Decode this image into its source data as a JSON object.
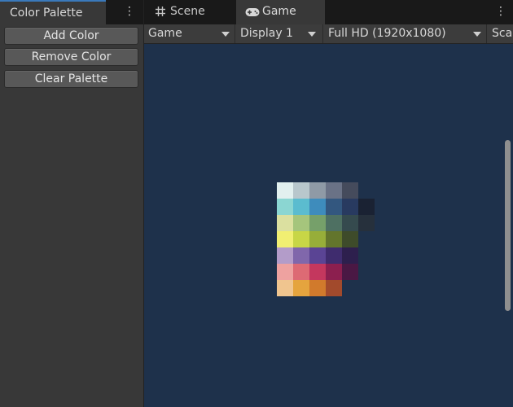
{
  "left_panel": {
    "tab_title": "Color Palette",
    "buttons": [
      "Add Color",
      "Remove Color",
      "Clear Palette"
    ]
  },
  "right_panel": {
    "tabs": [
      {
        "label": "Scene",
        "icon": "grid-icon"
      },
      {
        "label": "Game",
        "icon": "gamepad-icon"
      }
    ],
    "toolbar": {
      "view_mode": "Game",
      "display": "Display 1",
      "resolution": "Full HD (1920x1080)",
      "scale_label": "Sca"
    }
  },
  "colors": {
    "viewport_bg": "#1e314b",
    "accent": "#3a79bb"
  },
  "palette_rows": [
    [
      "#e2f0ef",
      "#b8c7cc",
      "#8f9aa6",
      "#6a7286",
      "#454b5c"
    ],
    [
      "#8bd6d2",
      "#5bbccf",
      "#3e8cbc",
      "#33577f",
      "#283a60",
      "#1a2233"
    ],
    [
      "#dbe0a0",
      "#a5c57c",
      "#76a06a",
      "#4e7062",
      "#354a4e",
      "#26303c"
    ],
    [
      "#f1ef72",
      "#c8d646",
      "#97ae39",
      "#63752c",
      "#3e4b2a"
    ],
    [
      "#b39cc9",
      "#8067ab",
      "#5a4494",
      "#3f2c6e",
      "#2d1f4d"
    ],
    [
      "#eea2a0",
      "#dd6a74",
      "#c4375e",
      "#8c1f4f",
      "#4a1844"
    ],
    [
      "#f0c58f",
      "#e5a43e",
      "#d17a2c",
      "#a24a2c"
    ]
  ]
}
